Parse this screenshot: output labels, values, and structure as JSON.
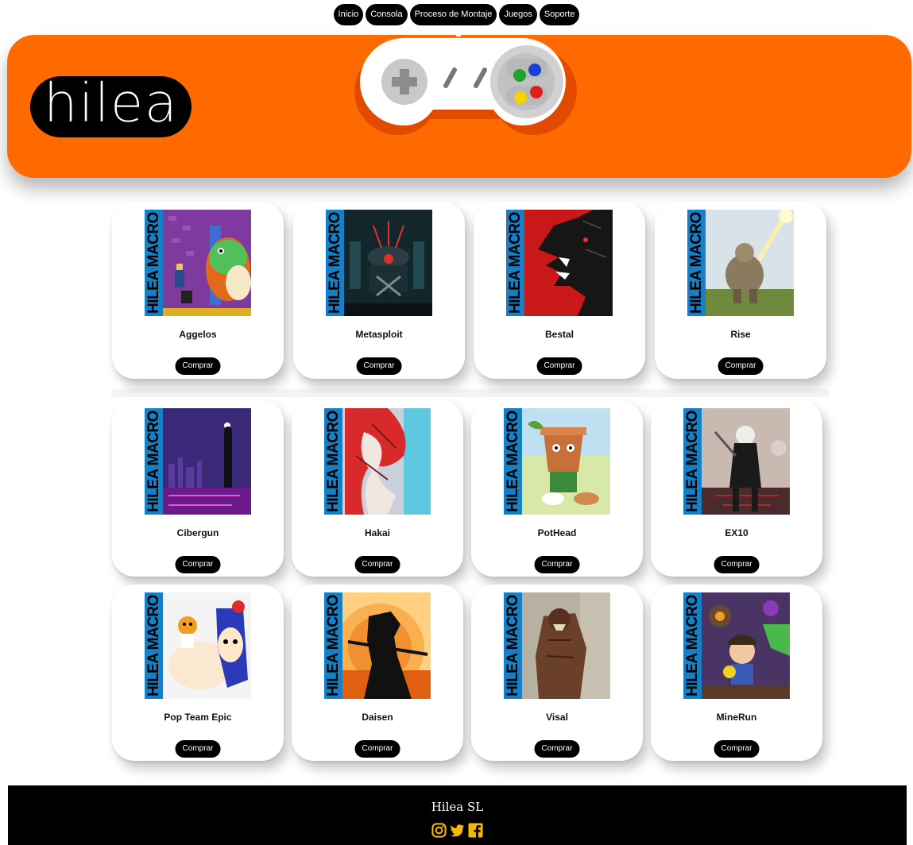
{
  "nav": {
    "items": [
      "Inicio",
      "Consola",
      "Proceso de Montaje",
      "Juegos",
      "Soporte"
    ]
  },
  "header": {
    "logo_text": "hilea",
    "background": "#ff6a00"
  },
  "thumbnail_band_text": "HILEA MACRO",
  "products": [
    {
      "title": "Aggelos",
      "button": "Comprar"
    },
    {
      "title": "Metasploit",
      "button": "Comprar"
    },
    {
      "title": "Bestal",
      "button": "Comprar"
    },
    {
      "title": "Rise",
      "button": "Comprar"
    },
    {
      "title": "Cibergun",
      "button": "Comprar"
    },
    {
      "title": "Hakai",
      "button": "Comprar"
    },
    {
      "title": "PotHead",
      "button": "Comprar"
    },
    {
      "title": "EX10",
      "button": "Comprar"
    },
    {
      "title": "Pop Team Epic",
      "button": "Comprar"
    },
    {
      "title": "Daisen",
      "button": "Comprar"
    },
    {
      "title": "Visal",
      "button": "Comprar"
    },
    {
      "title": "MineRun",
      "button": "Comprar"
    }
  ],
  "footer": {
    "company": "Hilea SL",
    "social_icons": [
      "instagram-icon",
      "twitter-icon",
      "facebook-icon"
    ],
    "icon_color": "#f5b800"
  },
  "colors": {
    "accent": "#ff6a00",
    "stripe": "#1380c8",
    "button": "#000000"
  }
}
